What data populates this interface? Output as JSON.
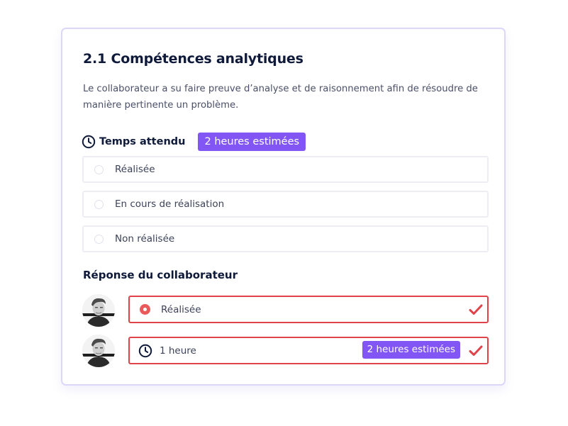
{
  "section": {
    "title": "2.1 Compétences analytiques",
    "description": "Le collaborateur a su faire preuve d’analyse et de raisonnement afin de résoudre de manière pertinente un problème.",
    "time_label": "Temps attendu",
    "time_badge": "2 heures estimées",
    "time_icon": "clock-icon"
  },
  "options": [
    {
      "label": "Réalisée"
    },
    {
      "label": "En cours de réalisation"
    },
    {
      "label": "Non réalisée"
    }
  ],
  "response": {
    "title": "Réponse du collaborateur",
    "status_label": "Réalisée",
    "time_value": "1 heure",
    "time_badge": "2 heures estimées",
    "check_icon": "checkmark-icon"
  },
  "colors": {
    "accent": "#8256f4",
    "error_border": "#e0444a",
    "check": "#e0444a",
    "title": "#0f1a3a"
  }
}
